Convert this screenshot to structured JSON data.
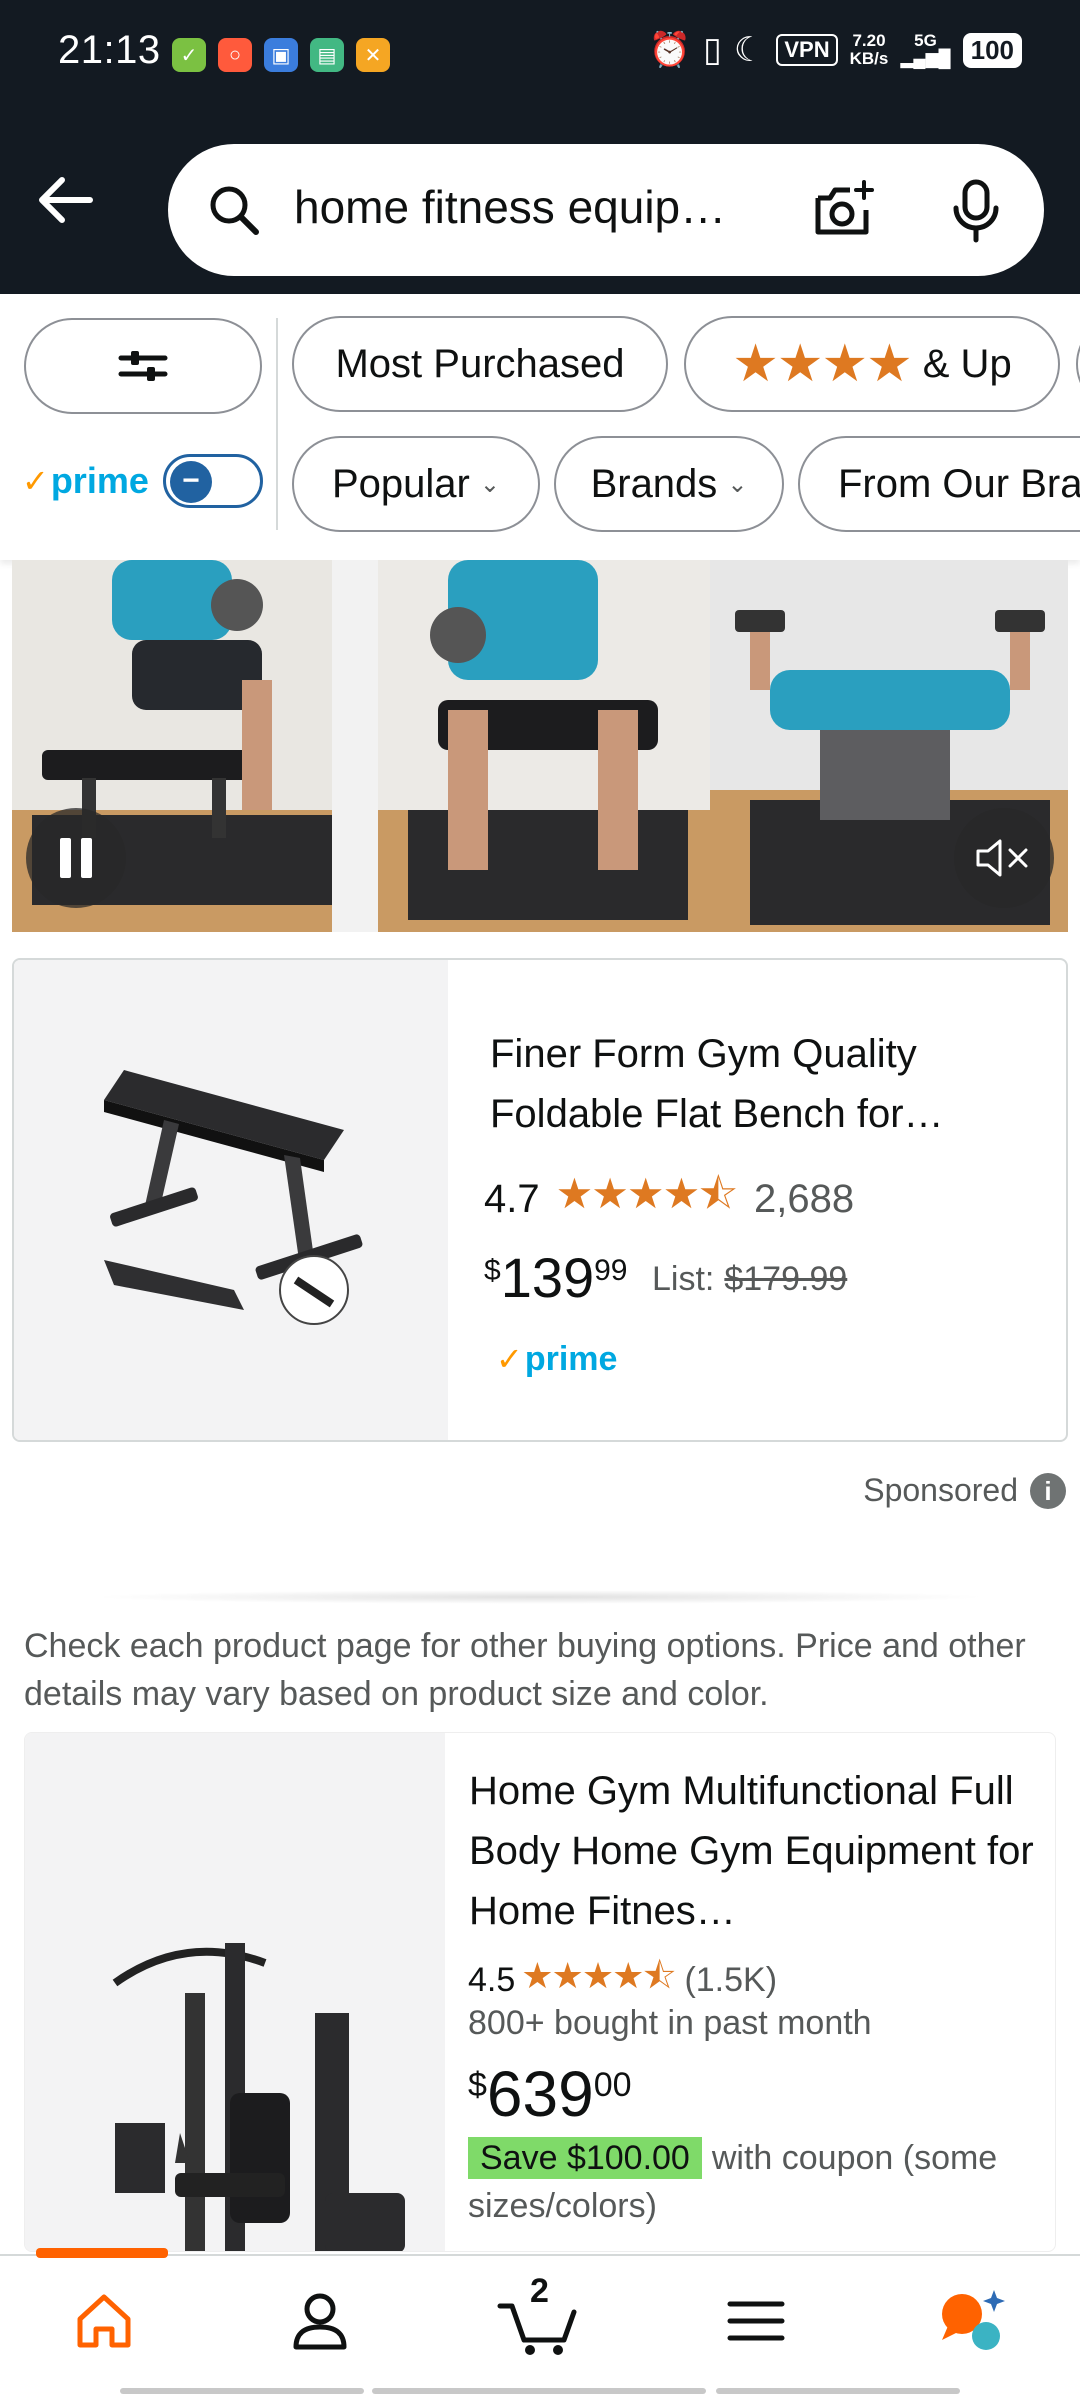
{
  "status_bar": {
    "time": "21:13",
    "vpn": "VPN",
    "net_speed_value": "7.20",
    "net_speed_unit": "KB/s",
    "network": "5G",
    "battery": "100"
  },
  "search": {
    "query": "home fitness equip…"
  },
  "filters": {
    "most_purchased": "Most Purchased",
    "stars_up": "& Up",
    "prime": "prime",
    "popular": "Popular",
    "brands": "Brands",
    "from_our_brands": "From Our Bra"
  },
  "sponsored_product": {
    "title": "Finer Form Gym Quality Foldable Flat Bench for…",
    "rating": "4.7",
    "stars": "★★★★⯪",
    "rating_count": "2,688",
    "price_symbol": "$",
    "price_whole": "139",
    "price_fraction": "99",
    "list_label": "List:",
    "list_price": "$179.99",
    "prime": "prime"
  },
  "sponsored_label": "Sponsored",
  "disclaimer": "Check each product page for other buying options. Price and other details may vary based on product size and color.",
  "product": {
    "title": "Home Gym Multifunctional Full Body Home Gym Equipment for Home Fitnes…",
    "rating": "4.5",
    "stars": "★★★★⯪",
    "rating_count": "(1.5K)",
    "bought": "800+ bought in past month",
    "price_symbol": "$",
    "price_whole": "639",
    "price_fraction": "00",
    "coupon": "Save $100.00",
    "coupon_text": "with coupon (some sizes/colors)"
  },
  "bottom_nav": {
    "cart_count": "2"
  },
  "colors": {
    "header_bg": "#131a22",
    "accent_orange": "#ff6200",
    "star_orange": "#de7921",
    "prime_blue": "#00a8e1",
    "coupon_green": "#7fda69"
  }
}
